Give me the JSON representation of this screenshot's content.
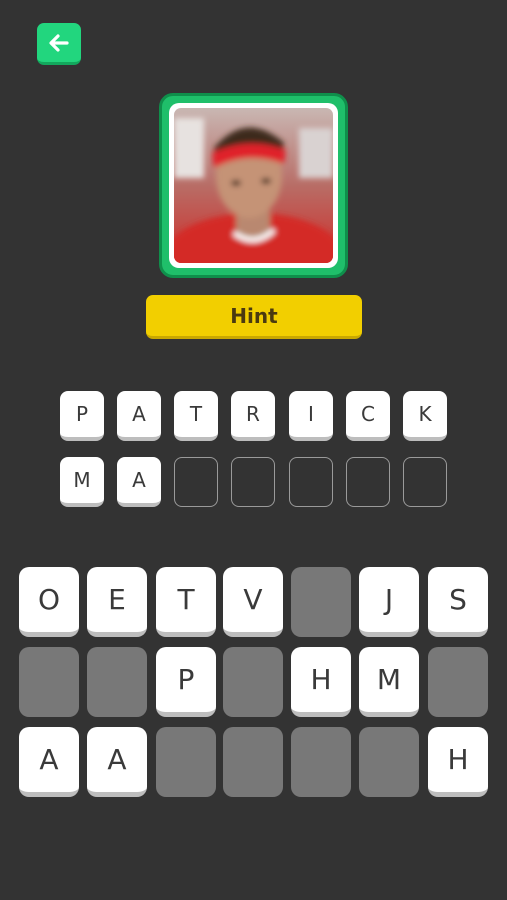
{
  "colors": {
    "background": "#333333",
    "back_button": "#22d67e",
    "photo_frame": "#1fbf6a",
    "hint_button": "#f2cf00",
    "tile": "#ffffff",
    "used_key": "#787878"
  },
  "back_button": {
    "icon": "arrow-left-icon"
  },
  "photo": {
    "subject": "player-photo"
  },
  "hint_button": {
    "label": "Hint"
  },
  "answer": {
    "rows": [
      [
        "P",
        "A",
        "T",
        "R",
        "I",
        "C",
        "K"
      ],
      [
        "M",
        "A",
        "",
        "",
        "",
        "",
        ""
      ]
    ]
  },
  "keyboard": {
    "rows": [
      [
        "O",
        "E",
        "T",
        "V",
        "",
        "J",
        "S"
      ],
      [
        "",
        "",
        "P",
        "",
        "H",
        "M",
        ""
      ],
      [
        "A",
        "A",
        "",
        "",
        "",
        "",
        "H"
      ]
    ]
  }
}
